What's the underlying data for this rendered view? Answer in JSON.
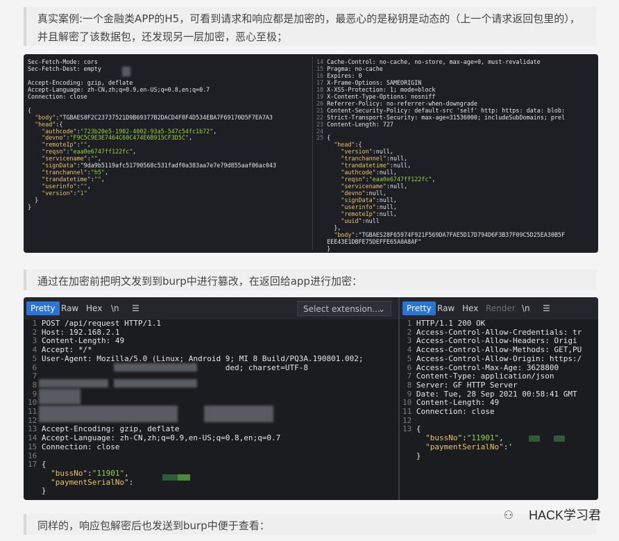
{
  "quote1": "真实案例:一个金融类APP的H5，可看到请求和响应都是加密的，最恶心的是秘钥是动态的（上一个请求返回包里的），并且解密了该数据包，还发现另一层加密，恶心至极；",
  "quote2": "通过在加密前把明文发到到burp中进行篡改，在返回给app进行加密：",
  "quote3": "同样的，响应包解密后也发送到burp中便于查看：",
  "watermark": "HACK学习君",
  "panel1": {
    "left_lines": [
      "Sec-Fetch-Mode: cors",
      "Sec-Fetch-Dest: empty",
      "",
      "Accept-Encoding: gzip, deflate",
      "Accept-Language: zh-CN,zh;q=0.9,en-US;q=0.8,en;q=0.7",
      "Connection: close",
      "",
      "{",
      "  \"body\":\"TGBAES8F2C23737521D9B69377B2DACD4F8F4D534EBA7F69170D5F7EA7A3",
      "  \"head\":{",
      "    \"authcode\":\"723b20e5-1902-4002-93a5-547c54fc1b72\",",
      "    \"devno\":\"F9C5C9E3E7464C60C474E6B915CF3D5C\",",
      "    \"remoteIp\":\"\",",
      "    \"reqsn\":\"eaa0e6747ff122fc\",",
      "    \"servicename\":\"\",",
      "    \"signData\":\"9da9b5119afc51790568c531fadf0a383aa7e7e79d855aaf06ac043",
      "    \"tranchannel\":\"h5\",",
      "    \"trandatetime\":\"\",",
      "    \"userinfo\":\"\",",
      "    \"version\":\"1\"",
      "  }",
      "}"
    ],
    "right_lines": [
      "14 Cache-Control: no-cache, no-store, max-age=0, must-revalidate",
      "15 Pragma: no-cache",
      "16 Expires: 0",
      "17 X-Frame-Options: SAMEORIGIN",
      "18 X-XSS-Protection: 1; mode=block",
      "19 X-Content-Type-Options: nosniff",
      "20 Referrer-Policy: no-referrer-when-downgrade",
      "21 Content-Security-Policy: default-src 'self' http: https: data: blob:",
      "22 Strict-Transport-Security: max-age=31536000; includeSubDomains; prel",
      "23 Content-Length: 727",
      "24",
      "25 {",
      "     \"head\":{",
      "       \"version\":null,",
      "       \"tranchannel\":null,",
      "       \"trandatetime\":null,",
      "       \"authcode\":null,",
      "       \"reqsn\":\"eaa0e6747ff122fc\",",
      "       \"servicename\":null,",
      "       \"devno\":null,",
      "       \"signData\":null,",
      "       \"userinfo\":null,",
      "       \"remoteIp\":null,",
      "       \"uuid\":null",
      "     },",
      "     \"body\":\"TGBAES28F65974F921F569DA7FAE5D17D794D6F3B37F09C5D25EA30B5F",
      "   EEE43E1DBFE75DEFFE65A0A8AF\"",
      "   }"
    ]
  },
  "panel2": {
    "left_tabs": {
      "pretty": "Pretty",
      "raw": "Raw",
      "hex": "Hex",
      "newline": "\\n",
      "menu": "☰"
    },
    "right_tabs": {
      "pretty": "Pretty",
      "raw": "Raw",
      "hex": "Hex",
      "render": "Render",
      "newline": "\\n",
      "menu": "☰"
    },
    "select_ext": "Select extension...",
    "left_lines": [
      " 1 POST /api/request HTTP/1.1",
      " 2 Host: 192.168.2.1",
      " 3 Content-Length: 49",
      " 4 Accept: */*",
      " 5 User-Agent: Mozilla/5.0 (Linux; Android 9; MI 8 Build/PQ3A.190801.002;",
      " 6                                         ded; charset=UTF-8",
      " 7",
      " 8",
      " 9",
      "10",
      "11",
      "12",
      "13 Accept-Encoding: gzip, deflate",
      "14 Accept-Language: zh-CN,zh;q=0.9,en-US;q=0.8,en;q=0.7",
      "15 Connection: close",
      "16",
      "17 {",
      "     \"bussNo\":\"11901\",",
      "     \"paymentSerialNo\":",
      "   }"
    ],
    "right_lines": [
      " 1 HTTP/1.1 200 OK",
      " 2 Access-Control-Allow-Credentials: tr",
      " 3 Access-Control-Allow-Headers: Origi",
      " 4 Access-Control-Allow-Methods: GET,PU",
      " 5 Access-Control-Allow-Origin: https:/",
      " 6 Access-Control-Max-Age: 3628800",
      " 7 Content-Type: application/json",
      " 8 Server: GF HTTP Server",
      " 9 Date: Tue, 28 Sep 2021 00:58:41 GMT",
      "10 Content-Length: 49",
      "11 Connection: close",
      "12",
      "13 {",
      "     \"bussNo\":\"11901\",",
      "     \"paymentSerialNo\":'",
      "   }"
    ]
  }
}
